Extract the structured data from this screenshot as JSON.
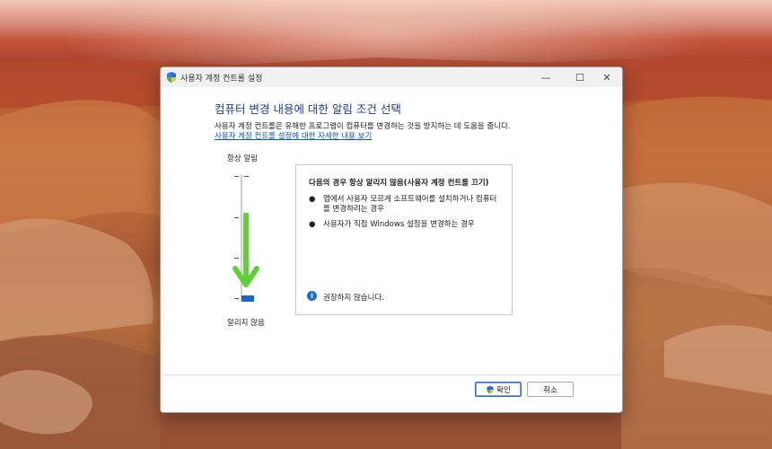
{
  "window": {
    "title": "사용자 계정 컨트롤 설정",
    "icon": "uac-shield-icon",
    "controls": {
      "minimize": "—",
      "maximize": "☐",
      "close": "✕"
    }
  },
  "main": {
    "heading": "컴퓨터 변경 내용에 대한 알림 조건 선택",
    "description": "사용자 계정 컨트롤은 유해한 프로그램이 컴퓨터를 변경하는 것을 방지하는 데 도움을 줍니다.",
    "more_link": "사용자 계정 컨트롤 설정에 대한 자세한 내용 보기"
  },
  "slider": {
    "top_label": "항상 알림",
    "bottom_label": "알리지 않음",
    "levels": 4,
    "selected_level": 1,
    "arrow_color": "#5fcf3a",
    "thumb_color": "#1668c7"
  },
  "info": {
    "title": "다음의 경우 항상 알리지 않음(사용자 계정 컨트롤 끄기)",
    "bullets": [
      "앱에서 사용자 모르게 소프트웨어를 설치하거나 컴퓨터를 변경하려는 경우",
      "사용자가 직접 Windows 설정을 변경하는 경우"
    ],
    "bullet_mark": "●",
    "recommendation_icon": "info-icon",
    "recommendation_icon_glyph": "i",
    "recommendation": "권장하지 않습니다."
  },
  "footer": {
    "ok_label": "확인",
    "cancel_label": "취소"
  }
}
